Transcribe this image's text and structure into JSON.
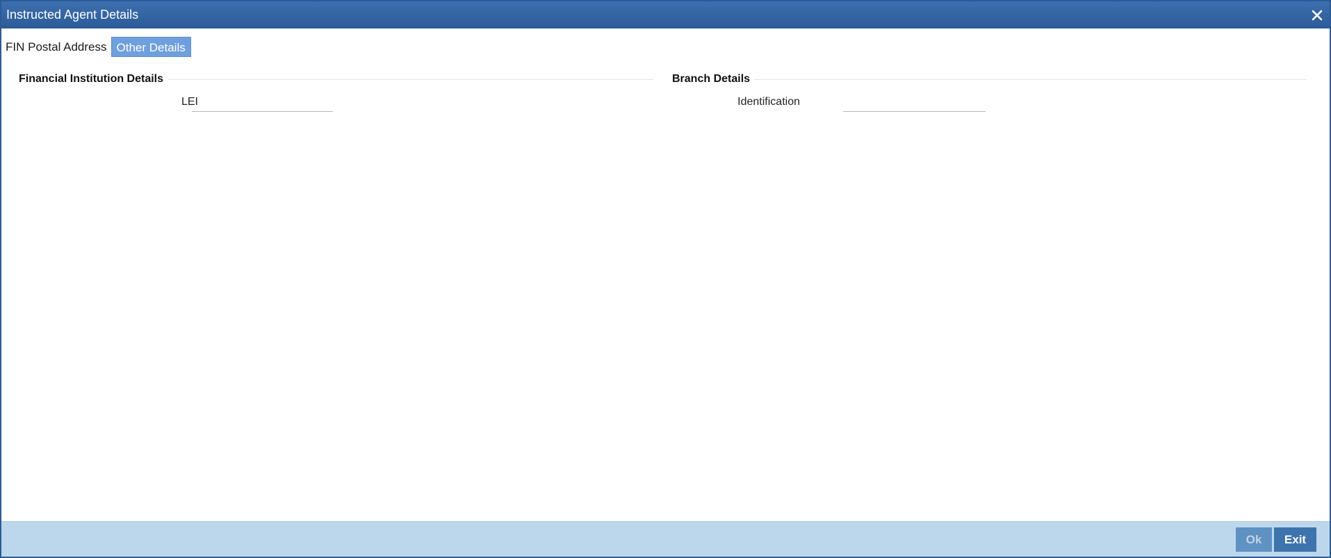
{
  "window": {
    "title": "Instructed Agent Details"
  },
  "tabs": [
    {
      "label": "FIN Postal Address",
      "active": false
    },
    {
      "label": "Other Details",
      "active": true
    }
  ],
  "sections": {
    "financial_institution": {
      "title": "Financial Institution Details",
      "fields": {
        "lei": {
          "label": "LEI",
          "value": ""
        }
      }
    },
    "branch": {
      "title": "Branch Details",
      "fields": {
        "identification": {
          "label": "Identification",
          "value": ""
        }
      }
    }
  },
  "footer": {
    "ok_label": "Ok",
    "exit_label": "Exit"
  },
  "colors": {
    "titlebar": "#2b5b98",
    "active_tab": "#6f9fdc",
    "footer": "#bcd7ec",
    "button": "#3e74ad"
  },
  "icons": {
    "close": "close-icon"
  }
}
